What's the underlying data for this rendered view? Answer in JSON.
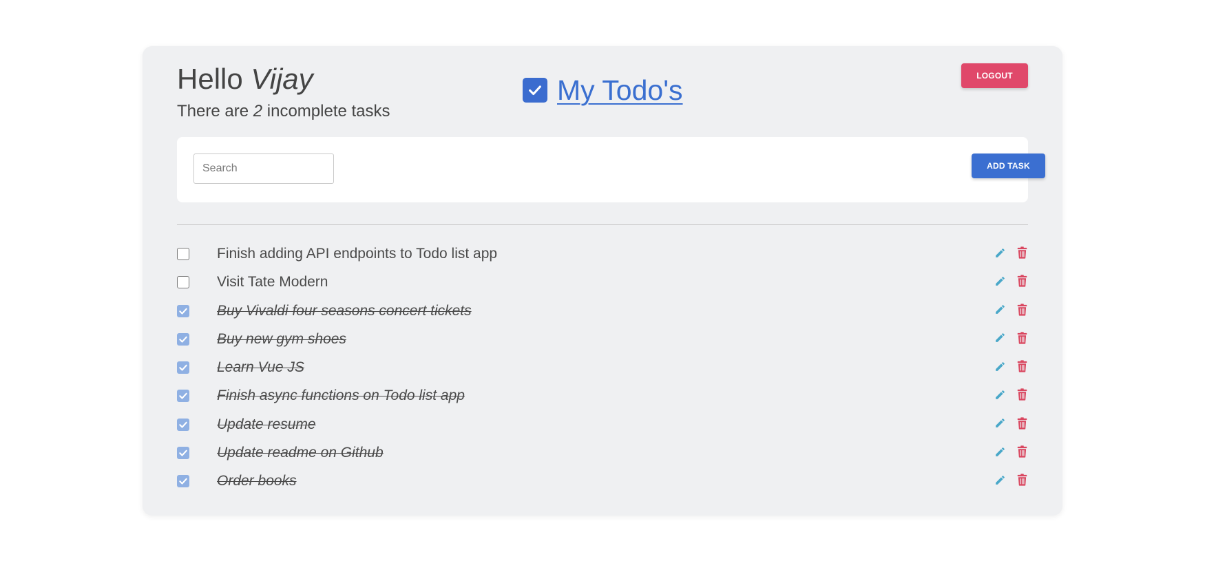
{
  "header": {
    "greeting": "Hello",
    "user_name": "Vijay",
    "subtitle_prefix": "There are",
    "incomplete_count": "2",
    "subtitle_suffix": "incomplete tasks"
  },
  "brand": {
    "title": "My Todo's",
    "icon": "checkbox-checked-icon"
  },
  "buttons": {
    "logout": "LOGOUT",
    "add_task": "ADD TASK"
  },
  "search": {
    "placeholder": "Search",
    "value": ""
  },
  "tasks": [
    {
      "label": "Finish adding API endpoints to Todo list app",
      "completed": false
    },
    {
      "label": "Visit Tate Modern",
      "completed": false
    },
    {
      "label": "Buy Vivaldi four seasons concert tickets",
      "completed": true
    },
    {
      "label": "Buy new gym shoes",
      "completed": true
    },
    {
      "label": "Learn Vue JS",
      "completed": true
    },
    {
      "label": "Finish async functions on Todo list app",
      "completed": true
    },
    {
      "label": "Update resume",
      "completed": true
    },
    {
      "label": "Update readme on Github",
      "completed": true
    },
    {
      "label": "Order books",
      "completed": true
    }
  ],
  "icons": {
    "edit": "pencil-icon",
    "delete": "trash-icon",
    "check": "check-icon"
  },
  "colors": {
    "primary": "#3b6fd1",
    "danger": "#e0486a",
    "edit_icon": "#4aa8c9",
    "delete_icon": "#d9465f",
    "checked_box": "#8fb0e3",
    "card_bg": "#eff0f2"
  }
}
